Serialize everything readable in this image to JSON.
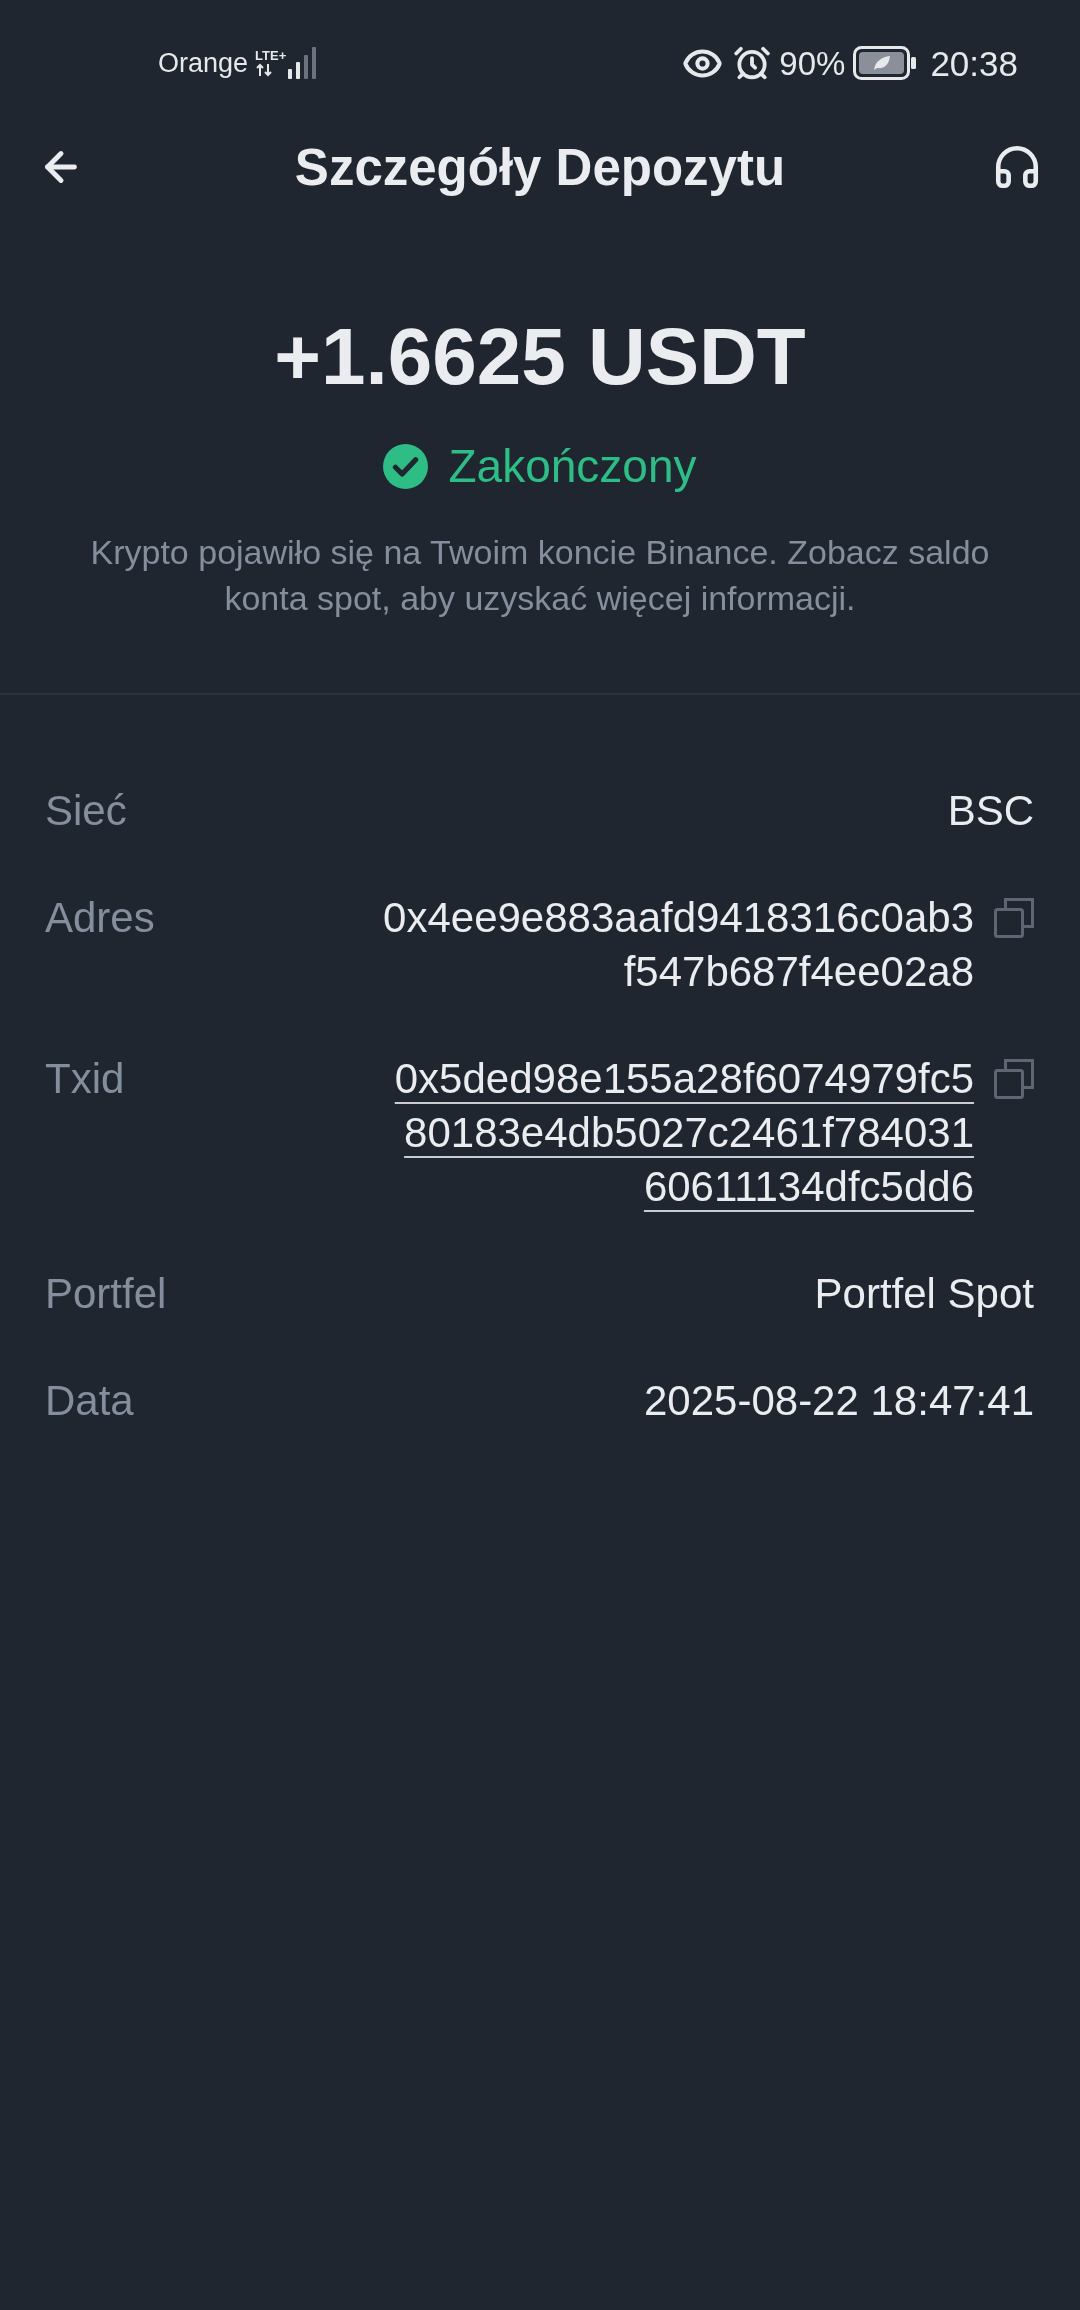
{
  "status_bar": {
    "carrier": "Orange",
    "network": "LTE+",
    "battery": "90%",
    "time": "20:38"
  },
  "header": {
    "title": "Szczegóły Depozytu"
  },
  "summary": {
    "amount": "+1.6625 USDT",
    "status": {
      "kind": "completed",
      "label": "Zakończony"
    },
    "note": "Krypto pojawiło się na Twoim koncie Binance. Zobacz saldo konta spot, aby uzyskać więcej informacji."
  },
  "details": [
    {
      "kind": "text",
      "label": "Sieć",
      "value": "BSC"
    },
    {
      "kind": "copyable",
      "label": "Adres",
      "value": "0x4ee9e883aafd9418316c0ab3f547b687f4ee02a8"
    },
    {
      "kind": "link",
      "label": "Txid",
      "value": "0x5ded98e155a28f6074979fc580183e4db5027c2461f78403160611134dfc5dd6"
    },
    {
      "kind": "text",
      "label": "Portfel",
      "value": "Portfel Spot"
    },
    {
      "kind": "text",
      "label": "Data",
      "value": "2025-08-22 18:47:41"
    }
  ]
}
